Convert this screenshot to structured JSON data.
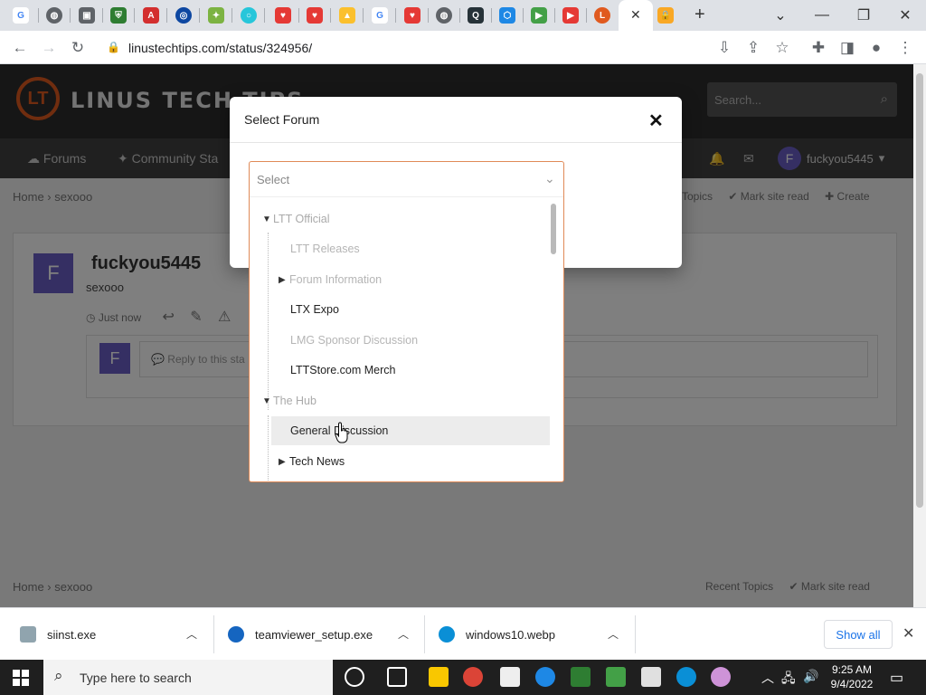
{
  "browser": {
    "url": "linustechtips.com/status/324956/",
    "tab_favicons": [
      "google-icon",
      "globe-icon",
      "document-icon",
      "shield-icon",
      "adobe-icon",
      "circle-icon",
      "puzzle-icon",
      "ring-icon",
      "brave-icon",
      "brave-icon",
      "drive-icon",
      "google-icon",
      "brave-icon",
      "globe-icon",
      "q-icon",
      "hex-icon",
      "play-icon",
      "youtube-icon",
      "ltt-icon"
    ]
  },
  "site": {
    "logo_text": "LINUS TECH TIPS",
    "search_placeholder": "Search...",
    "nav": {
      "forums": "Forums",
      "community": "Community Sta"
    },
    "user": {
      "initial": "F",
      "name": "fuckyou5445"
    },
    "breadcrumb": {
      "home": "Home",
      "current": "sexooo"
    },
    "page_links": {
      "topics": "Topics",
      "mark_read": "Mark site read",
      "create": "Create"
    },
    "post": {
      "avatar_initial": "F",
      "username": "fuckyou5445",
      "body": "sexooo",
      "time": "Just now",
      "reply_placeholder": "Reply to this sta"
    },
    "footer": {
      "home": "Home",
      "current": "sexooo",
      "recent": "Recent Topics",
      "mark_read": "Mark site read"
    }
  },
  "modal": {
    "title": "Select Forum",
    "select_placeholder": "Select",
    "options": [
      {
        "label": "LTT Official",
        "type": "group"
      },
      {
        "label": "LTT Releases",
        "type": "disabled"
      },
      {
        "label": "Forum Information",
        "type": "disabled-expandable"
      },
      {
        "label": "LTX Expo",
        "type": "enabled"
      },
      {
        "label": "LMG Sponsor Discussion",
        "type": "disabled"
      },
      {
        "label": "LTTStore.com Merch",
        "type": "enabled"
      },
      {
        "label": "The Hub",
        "type": "group"
      },
      {
        "label": "General Discussion",
        "type": "enabled-hover"
      },
      {
        "label": "Tech News",
        "type": "enabled-expandable"
      }
    ]
  },
  "downloads": {
    "items": [
      {
        "name": "siinst.exe"
      },
      {
        "name": "teamviewer_setup.exe"
      },
      {
        "name": "windows10.webp"
      }
    ],
    "show_all": "Show all"
  },
  "taskbar": {
    "search_placeholder": "Type here to search",
    "time": "9:25 AM",
    "date": "9/4/2022"
  },
  "colors": {
    "accent": "#e05a1f",
    "select_border": "#e08a57",
    "avatar": "#6b5fc7",
    "link_blue": "#1a73e8"
  }
}
